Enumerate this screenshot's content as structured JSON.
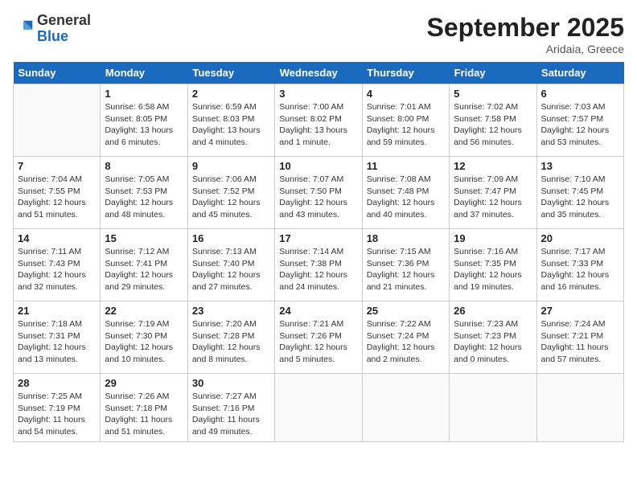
{
  "header": {
    "logo_general": "General",
    "logo_blue": "Blue",
    "month_title": "September 2025",
    "location": "Aridaia, Greece"
  },
  "days_of_week": [
    "Sunday",
    "Monday",
    "Tuesday",
    "Wednesday",
    "Thursday",
    "Friday",
    "Saturday"
  ],
  "weeks": [
    [
      {
        "day": "",
        "info": ""
      },
      {
        "day": "1",
        "info": "Sunrise: 6:58 AM\nSunset: 8:05 PM\nDaylight: 13 hours\nand 6 minutes."
      },
      {
        "day": "2",
        "info": "Sunrise: 6:59 AM\nSunset: 8:03 PM\nDaylight: 13 hours\nand 4 minutes."
      },
      {
        "day": "3",
        "info": "Sunrise: 7:00 AM\nSunset: 8:02 PM\nDaylight: 13 hours\nand 1 minute."
      },
      {
        "day": "4",
        "info": "Sunrise: 7:01 AM\nSunset: 8:00 PM\nDaylight: 12 hours\nand 59 minutes."
      },
      {
        "day": "5",
        "info": "Sunrise: 7:02 AM\nSunset: 7:58 PM\nDaylight: 12 hours\nand 56 minutes."
      },
      {
        "day": "6",
        "info": "Sunrise: 7:03 AM\nSunset: 7:57 PM\nDaylight: 12 hours\nand 53 minutes."
      }
    ],
    [
      {
        "day": "7",
        "info": "Sunrise: 7:04 AM\nSunset: 7:55 PM\nDaylight: 12 hours\nand 51 minutes."
      },
      {
        "day": "8",
        "info": "Sunrise: 7:05 AM\nSunset: 7:53 PM\nDaylight: 12 hours\nand 48 minutes."
      },
      {
        "day": "9",
        "info": "Sunrise: 7:06 AM\nSunset: 7:52 PM\nDaylight: 12 hours\nand 45 minutes."
      },
      {
        "day": "10",
        "info": "Sunrise: 7:07 AM\nSunset: 7:50 PM\nDaylight: 12 hours\nand 43 minutes."
      },
      {
        "day": "11",
        "info": "Sunrise: 7:08 AM\nSunset: 7:48 PM\nDaylight: 12 hours\nand 40 minutes."
      },
      {
        "day": "12",
        "info": "Sunrise: 7:09 AM\nSunset: 7:47 PM\nDaylight: 12 hours\nand 37 minutes."
      },
      {
        "day": "13",
        "info": "Sunrise: 7:10 AM\nSunset: 7:45 PM\nDaylight: 12 hours\nand 35 minutes."
      }
    ],
    [
      {
        "day": "14",
        "info": "Sunrise: 7:11 AM\nSunset: 7:43 PM\nDaylight: 12 hours\nand 32 minutes."
      },
      {
        "day": "15",
        "info": "Sunrise: 7:12 AM\nSunset: 7:41 PM\nDaylight: 12 hours\nand 29 minutes."
      },
      {
        "day": "16",
        "info": "Sunrise: 7:13 AM\nSunset: 7:40 PM\nDaylight: 12 hours\nand 27 minutes."
      },
      {
        "day": "17",
        "info": "Sunrise: 7:14 AM\nSunset: 7:38 PM\nDaylight: 12 hours\nand 24 minutes."
      },
      {
        "day": "18",
        "info": "Sunrise: 7:15 AM\nSunset: 7:36 PM\nDaylight: 12 hours\nand 21 minutes."
      },
      {
        "day": "19",
        "info": "Sunrise: 7:16 AM\nSunset: 7:35 PM\nDaylight: 12 hours\nand 19 minutes."
      },
      {
        "day": "20",
        "info": "Sunrise: 7:17 AM\nSunset: 7:33 PM\nDaylight: 12 hours\nand 16 minutes."
      }
    ],
    [
      {
        "day": "21",
        "info": "Sunrise: 7:18 AM\nSunset: 7:31 PM\nDaylight: 12 hours\nand 13 minutes."
      },
      {
        "day": "22",
        "info": "Sunrise: 7:19 AM\nSunset: 7:30 PM\nDaylight: 12 hours\nand 10 minutes."
      },
      {
        "day": "23",
        "info": "Sunrise: 7:20 AM\nSunset: 7:28 PM\nDaylight: 12 hours\nand 8 minutes."
      },
      {
        "day": "24",
        "info": "Sunrise: 7:21 AM\nSunset: 7:26 PM\nDaylight: 12 hours\nand 5 minutes."
      },
      {
        "day": "25",
        "info": "Sunrise: 7:22 AM\nSunset: 7:24 PM\nDaylight: 12 hours\nand 2 minutes."
      },
      {
        "day": "26",
        "info": "Sunrise: 7:23 AM\nSunset: 7:23 PM\nDaylight: 12 hours\nand 0 minutes."
      },
      {
        "day": "27",
        "info": "Sunrise: 7:24 AM\nSunset: 7:21 PM\nDaylight: 11 hours\nand 57 minutes."
      }
    ],
    [
      {
        "day": "28",
        "info": "Sunrise: 7:25 AM\nSunset: 7:19 PM\nDaylight: 11 hours\nand 54 minutes."
      },
      {
        "day": "29",
        "info": "Sunrise: 7:26 AM\nSunset: 7:18 PM\nDaylight: 11 hours\nand 51 minutes."
      },
      {
        "day": "30",
        "info": "Sunrise: 7:27 AM\nSunset: 7:16 PM\nDaylight: 11 hours\nand 49 minutes."
      },
      {
        "day": "",
        "info": ""
      },
      {
        "day": "",
        "info": ""
      },
      {
        "day": "",
        "info": ""
      },
      {
        "day": "",
        "info": ""
      }
    ]
  ]
}
